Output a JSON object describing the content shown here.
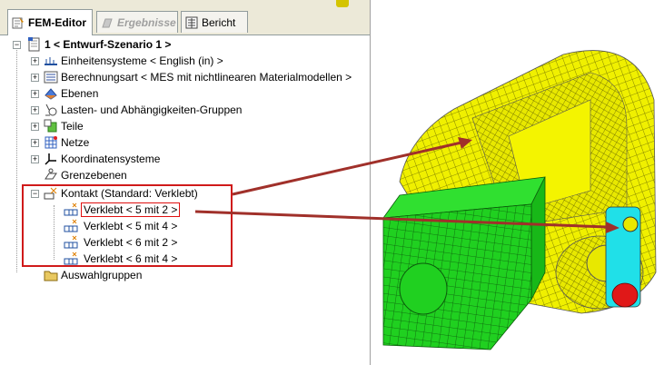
{
  "tabs": [
    {
      "label": "FEM-Editor",
      "state": "active"
    },
    {
      "label": "Ergebnisse",
      "state": "disabled"
    },
    {
      "label": "Bericht",
      "state": "normal"
    }
  ],
  "tree": {
    "root": "1 < Entwurf-Szenario 1 >",
    "items": [
      {
        "label": "Einheitensysteme < English (in) >",
        "icon": "units-icon"
      },
      {
        "label": "Berechnungsart < MES mit nichtlinearen Materialmodellen >",
        "icon": "analysis-type-icon"
      },
      {
        "label": "Ebenen",
        "icon": "layers-icon"
      },
      {
        "label": "Lasten- und Abhängigkeiten-Gruppen",
        "icon": "loads-constraints-icon"
      },
      {
        "label": "Teile",
        "icon": "parts-icon"
      },
      {
        "label": "Netze",
        "icon": "mesh-icon"
      },
      {
        "label": "Koordinatensysteme",
        "icon": "coordinate-system-icon"
      },
      {
        "label": "Grenzebenen",
        "icon": "clipping-plane-icon"
      },
      {
        "label": "Kontakt (Standard: Verklebt)",
        "icon": "contact-icon"
      }
    ],
    "contact_children": [
      {
        "label": "Verklebt < 5 mit 2 >"
      },
      {
        "label": "Verklebt < 5 mit 4 >"
      },
      {
        "label": "Verklebt < 6 mit 2 >"
      },
      {
        "label": "Verklebt < 6 mit 4 >"
      }
    ],
    "last_item": {
      "label": "Auswahlgruppen",
      "icon": "folder-icon"
    }
  },
  "colors": {
    "highlight": "#d01a1a",
    "arrow": "#a0302a",
    "mesh_yellow": "#f0f000",
    "mesh_green": "#20d020",
    "mesh_cyan": "#20e0e8",
    "mesh_red": "#e01818"
  }
}
